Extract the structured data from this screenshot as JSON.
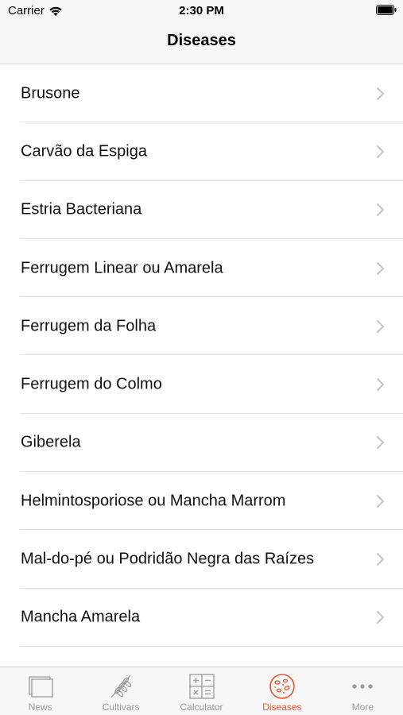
{
  "status_bar": {
    "carrier": "Carrier",
    "time": "2:30 PM"
  },
  "nav": {
    "title": "Diseases"
  },
  "diseases": [
    "Brusone",
    "Carvão da Espiga",
    "Estria Bacteriana",
    "Ferrugem Linear ou Amarela",
    "Ferrugem da Folha",
    "Ferrugem do Colmo",
    "Giberela",
    "Helmintosporiose ou Mancha Marrom",
    "Mal-do-pé ou Podridão Negra das Raízes",
    "Mancha Amarela"
  ],
  "tabs": [
    {
      "label": "News",
      "icon": "news-icon"
    },
    {
      "label": "Cultivars",
      "icon": "wheat-icon"
    },
    {
      "label": "Calculator",
      "icon": "calculator-icon"
    },
    {
      "label": "Diseases",
      "icon": "virus-icon",
      "active": true
    },
    {
      "label": "More",
      "icon": "more-icon"
    }
  ],
  "colors": {
    "accent": "#e4572e",
    "inactive": "#9a9a9a",
    "bar_bg": "#f7f7f7"
  }
}
